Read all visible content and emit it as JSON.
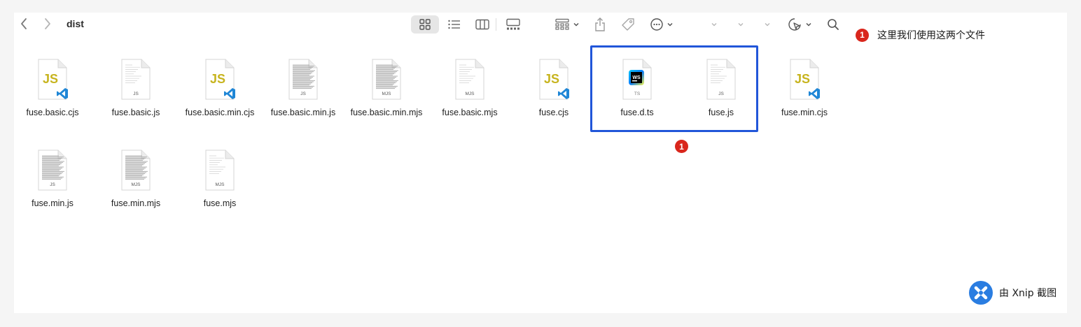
{
  "toolbar": {
    "back_icon": "chevron-left-icon",
    "forward_icon": "chevron-right-icon",
    "folder_title": "dist",
    "view_icons": [
      "grid-view-icon",
      "list-view-icon",
      "column-view-icon",
      "gallery-view-icon"
    ],
    "group_icon": "group-by-icon",
    "share_icon": "share-icon",
    "tag_icon": "tag-icon",
    "more_icon": "ellipsis-circle-icon",
    "markup_icon": "markup-icon",
    "search_icon": "search-icon"
  },
  "annotation": {
    "badge": "1",
    "text": "这里我们使用这两个文件",
    "badge_under_selection": "1"
  },
  "files": [
    {
      "name": "fuse.basic.cjs",
      "type": "vscode-js"
    },
    {
      "name": "fuse.basic.js",
      "type": "doc",
      "ext": "JS"
    },
    {
      "name": "fuse.basic.min.cjs",
      "type": "vscode-js"
    },
    {
      "name": "fuse.basic.min.js",
      "type": "doc-dense",
      "ext": "JS"
    },
    {
      "name": "fuse.basic.min.mjs",
      "type": "doc-dense",
      "ext": "MJS"
    },
    {
      "name": "fuse.basic.mjs",
      "type": "doc",
      "ext": "MJS"
    },
    {
      "name": "fuse.cjs",
      "type": "vscode-js"
    },
    {
      "name": "fuse.d.ts",
      "type": "webstorm-ts",
      "ext": "TS"
    },
    {
      "name": "fuse.js",
      "type": "doc",
      "ext": "JS"
    },
    {
      "name": "fuse.min.cjs",
      "type": "vscode-js"
    },
    {
      "name": "fuse.min.js",
      "type": "doc-dense",
      "ext": "JS"
    },
    {
      "name": "fuse.min.mjs",
      "type": "doc-dense",
      "ext": "MJS"
    },
    {
      "name": "fuse.mjs",
      "type": "doc",
      "ext": "MJS"
    }
  ],
  "watermark": {
    "text": "由 Xnip 截图"
  },
  "colors": {
    "selection_border": "#2156d9",
    "badge": "#d9261c",
    "js_yellow": "#c7b41e",
    "vscode_blue": "#1f86d6"
  }
}
